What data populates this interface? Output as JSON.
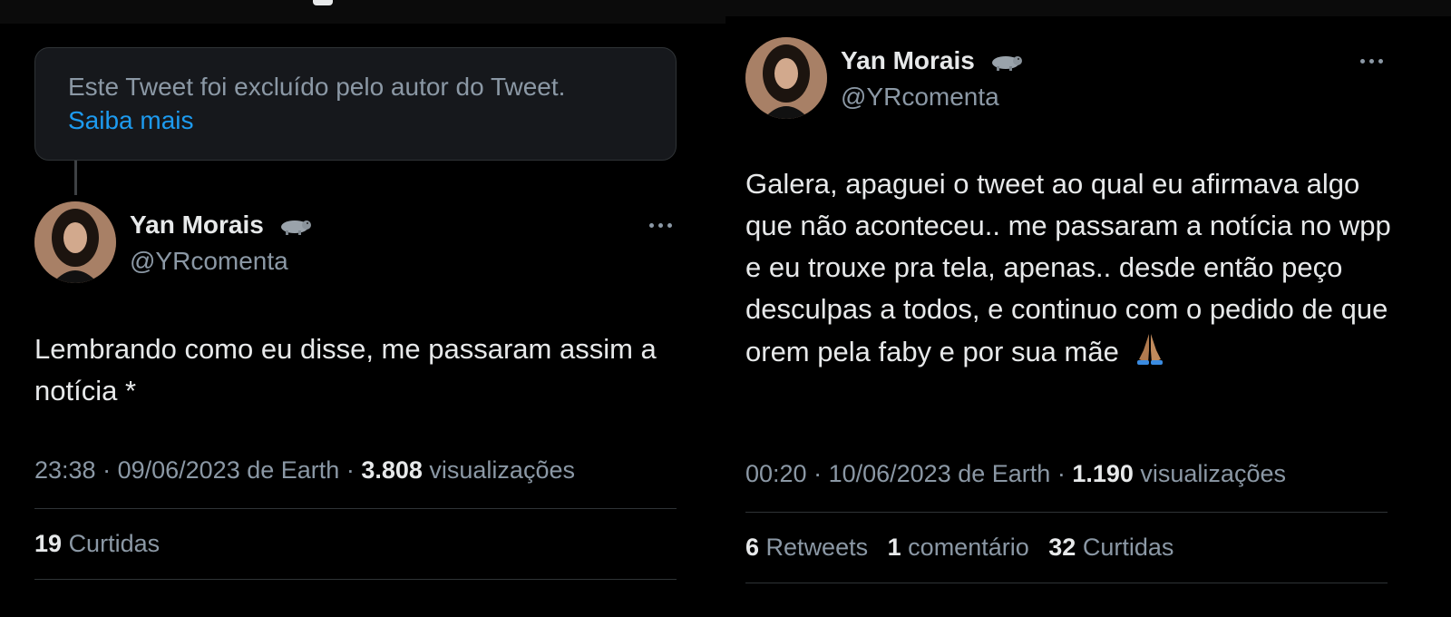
{
  "left": {
    "deleted_notice": "Este Tweet foi excluído pelo autor do Tweet.",
    "learn_more": "Saiba mais",
    "author": {
      "name": "Yan Morais",
      "handle": "@YRcomenta"
    },
    "tweet_text": "Lembrando como eu disse, me passaram assim a notícia *",
    "meta": {
      "time": "23:38",
      "date": "09/06/2023",
      "source": "de Earth",
      "views": "3.808",
      "views_label": "visualizações"
    },
    "stats": [
      {
        "count": "19",
        "label": "Curtidas"
      }
    ]
  },
  "right": {
    "author": {
      "name": "Yan Morais",
      "handle": "@YRcomenta"
    },
    "tweet_text": "Galera, apaguei o tweet ao qual eu afirmava algo que não aconteceu.. me passaram a notícia no wpp e eu trouxe pra tela, apenas.. desde então peço desculpas a todos, e continuo com o pedido de que orem pela faby e por sua mãe",
    "meta": {
      "time": "00:20",
      "date": "10/06/2023",
      "source": "de Earth",
      "views": "1.190",
      "views_label": "visualizações"
    },
    "stats": [
      {
        "count": "6",
        "label": "Retweets"
      },
      {
        "count": "1",
        "label": "comentário"
      },
      {
        "count": "32",
        "label": "Curtidas"
      }
    ]
  },
  "icons": {
    "badge": "hippo-emoji",
    "more": "more-horizontal-icon",
    "emoji_in_text": "folded-hands-emoji"
  }
}
